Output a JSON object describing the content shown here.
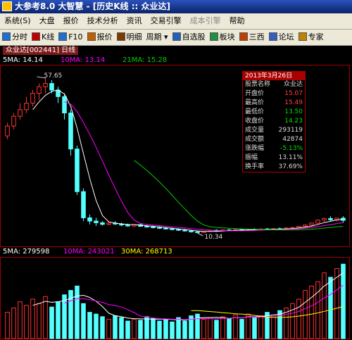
{
  "window": {
    "title": "大参考8.0 大智慧 - [历史K线 :: 众业达]"
  },
  "menu": [
    {
      "label": "系统(S)",
      "enabled": true
    },
    {
      "label": "大盘",
      "enabled": true
    },
    {
      "label": "报价",
      "enabled": true
    },
    {
      "label": "技术分析",
      "enabled": true
    },
    {
      "label": "资讯",
      "enabled": true
    },
    {
      "label": "交易引擎",
      "enabled": true
    },
    {
      "label": "成本引擎",
      "enabled": false
    },
    {
      "label": "帮助",
      "enabled": true
    }
  ],
  "toolbar": [
    {
      "label": "分时",
      "icon": "clock-icon",
      "color": "#1e6fd0"
    },
    {
      "label": "K线",
      "icon": "candle-icon",
      "color": "#c00000"
    },
    {
      "label": "F10",
      "icon": "f10-icon",
      "color": "#1e6fd0"
    },
    {
      "label": "报价",
      "icon": "grid-icon",
      "color": "#c06000"
    },
    {
      "label": "明细",
      "icon": "list-icon",
      "color": "#7a3a00"
    },
    {
      "label": "周期 ▾",
      "icon": "",
      "color": ""
    },
    {
      "label": "自选股",
      "icon": "star-icon",
      "color": "#2060c0"
    },
    {
      "label": "板块",
      "icon": "block-icon",
      "color": "#209040"
    },
    {
      "label": "三西",
      "icon": "sanxi-icon",
      "color": "#c04000"
    },
    {
      "label": "论坛",
      "icon": "forum-icon",
      "color": "#3060c0"
    },
    {
      "label": "专家",
      "icon": "expert-icon",
      "color": "#c08000"
    }
  ],
  "stock_tab": {
    "label": "众业达[002441] 日线"
  },
  "ma_legend": [
    {
      "label": "5MA: 14.14",
      "color": "#ffffff"
    },
    {
      "label": "10MA: 13.14",
      "color": "#ff00ff"
    },
    {
      "label": "21MA: 15.28",
      "color": "#00d000"
    }
  ],
  "info_panel": {
    "date": "2013年3月26日",
    "rows": [
      {
        "key": "股票名称",
        "value": "众业达",
        "color": "#dddddd"
      },
      {
        "key": "开盘价",
        "value": "15.07",
        "color": "#ff4040"
      },
      {
        "key": "最高价",
        "value": "15.49",
        "color": "#ff4040"
      },
      {
        "key": "最低价",
        "value": "13.50",
        "color": "#00e000"
      },
      {
        "key": "收盘价",
        "value": "14.23",
        "color": "#00e000"
      },
      {
        "key": "成交量",
        "value": "293119",
        "color": "#dddddd"
      },
      {
        "key": "成交额",
        "value": "42874",
        "color": "#dddddd"
      },
      {
        "key": "涨跌幅",
        "value": "-5.13%",
        "color": "#00e000"
      },
      {
        "key": "振幅",
        "value": "13.11%",
        "color": "#dddddd"
      },
      {
        "key": "换手率",
        "value": "37.69%",
        "color": "#dddddd"
      }
    ]
  },
  "price_annotations": {
    "high": "57.65",
    "low": "10.34"
  },
  "vol_legend": [
    {
      "label": "5MA: 279598",
      "color": "#ffffff"
    },
    {
      "label": "10MA: 243021",
      "color": "#ff00ff"
    },
    {
      "label": "30MA: 268713",
      "color": "#ffff00"
    }
  ],
  "chart_data": {
    "type": "candlestick",
    "colors": {
      "up": "#ff3232",
      "down": "#54ffff"
    },
    "candles": [
      [
        40,
        44,
        39,
        43
      ],
      [
        43,
        47,
        42,
        46
      ],
      [
        46,
        50,
        45,
        48
      ],
      [
        48,
        52,
        47,
        50
      ],
      [
        50,
        54,
        49,
        53
      ],
      [
        53,
        56,
        51,
        55
      ],
      [
        55,
        57.65,
        53,
        56
      ],
      [
        56,
        57,
        53,
        54
      ],
      [
        54,
        55,
        50,
        52
      ],
      [
        52,
        53,
        45,
        47
      ],
      [
        47,
        48,
        34,
        36
      ],
      [
        36,
        37,
        22,
        23
      ],
      [
        23,
        24,
        14,
        15
      ],
      [
        15,
        16,
        13,
        14
      ],
      [
        14,
        15,
        12.5,
        13.5
      ],
      [
        13.5,
        14,
        12.6,
        13
      ],
      [
        13,
        13.8,
        12.7,
        13.4
      ],
      [
        13.4,
        14,
        12.8,
        13.1
      ],
      [
        13.1,
        13.5,
        12.4,
        12.8
      ],
      [
        12.8,
        13.2,
        12.3,
        12.5
      ],
      [
        12.5,
        13,
        12.2,
        12.9
      ],
      [
        12.9,
        13.2,
        12.3,
        12.4
      ],
      [
        12.4,
        12.8,
        12,
        12.2
      ],
      [
        12.2,
        12.6,
        11.8,
        12
      ],
      [
        12,
        12.4,
        11.6,
        11.8
      ],
      [
        11.8,
        12.2,
        11.4,
        11.6
      ],
      [
        11.6,
        12,
        11.2,
        11.5
      ],
      [
        11.5,
        11.8,
        11,
        11.2
      ],
      [
        11.2,
        11.6,
        10.8,
        11
      ],
      [
        11,
        11.3,
        10.5,
        10.7
      ],
      [
        10.7,
        11,
        10.34,
        10.5
      ],
      [
        10.5,
        11,
        10.4,
        10.9
      ],
      [
        10.9,
        11.4,
        10.8,
        11.2
      ],
      [
        11.2,
        11.5,
        10.9,
        11
      ],
      [
        11,
        11.4,
        10.8,
        11.3
      ],
      [
        11.3,
        11.6,
        11,
        11.1
      ],
      [
        11.1,
        11.5,
        10.9,
        11.4
      ],
      [
        11.4,
        11.7,
        11.1,
        11.2
      ],
      [
        11.2,
        11.6,
        11,
        11.5
      ],
      [
        11.5,
        11.8,
        11.2,
        11.3
      ],
      [
        11.3,
        11.7,
        11.1,
        11.6
      ],
      [
        11.6,
        11.9,
        11.3,
        11.4
      ],
      [
        11.4,
        11.8,
        11.2,
        11.7
      ],
      [
        11.7,
        12,
        11.5,
        11.6
      ],
      [
        11.6,
        12,
        11.4,
        11.9
      ],
      [
        11.9,
        12.3,
        11.7,
        12
      ],
      [
        12,
        12.5,
        11.9,
        12.4
      ],
      [
        12.4,
        13,
        12.2,
        12.8
      ],
      [
        12.8,
        13.6,
        12.6,
        13.4
      ],
      [
        13.4,
        14.5,
        13.2,
        14.3
      ],
      [
        14.3,
        15,
        13.8,
        14.8
      ],
      [
        14.8,
        15.5,
        14,
        14.4
      ],
      [
        14.4,
        15,
        13.9,
        14.9
      ],
      [
        14.9,
        15.49,
        13.5,
        14.23
      ]
    ],
    "volume": [
      30,
      35,
      42,
      38,
      45,
      40,
      48,
      36,
      42,
      50,
      55,
      60,
      40,
      30,
      28,
      25,
      22,
      26,
      24,
      20,
      22,
      21,
      25,
      23,
      20,
      22,
      19,
      24,
      20,
      26,
      28,
      22,
      24,
      21,
      25,
      23,
      27,
      22,
      28,
      24,
      26,
      30,
      27,
      32,
      35,
      40,
      45,
      55,
      60,
      65,
      75,
      70,
      80,
      85
    ]
  }
}
